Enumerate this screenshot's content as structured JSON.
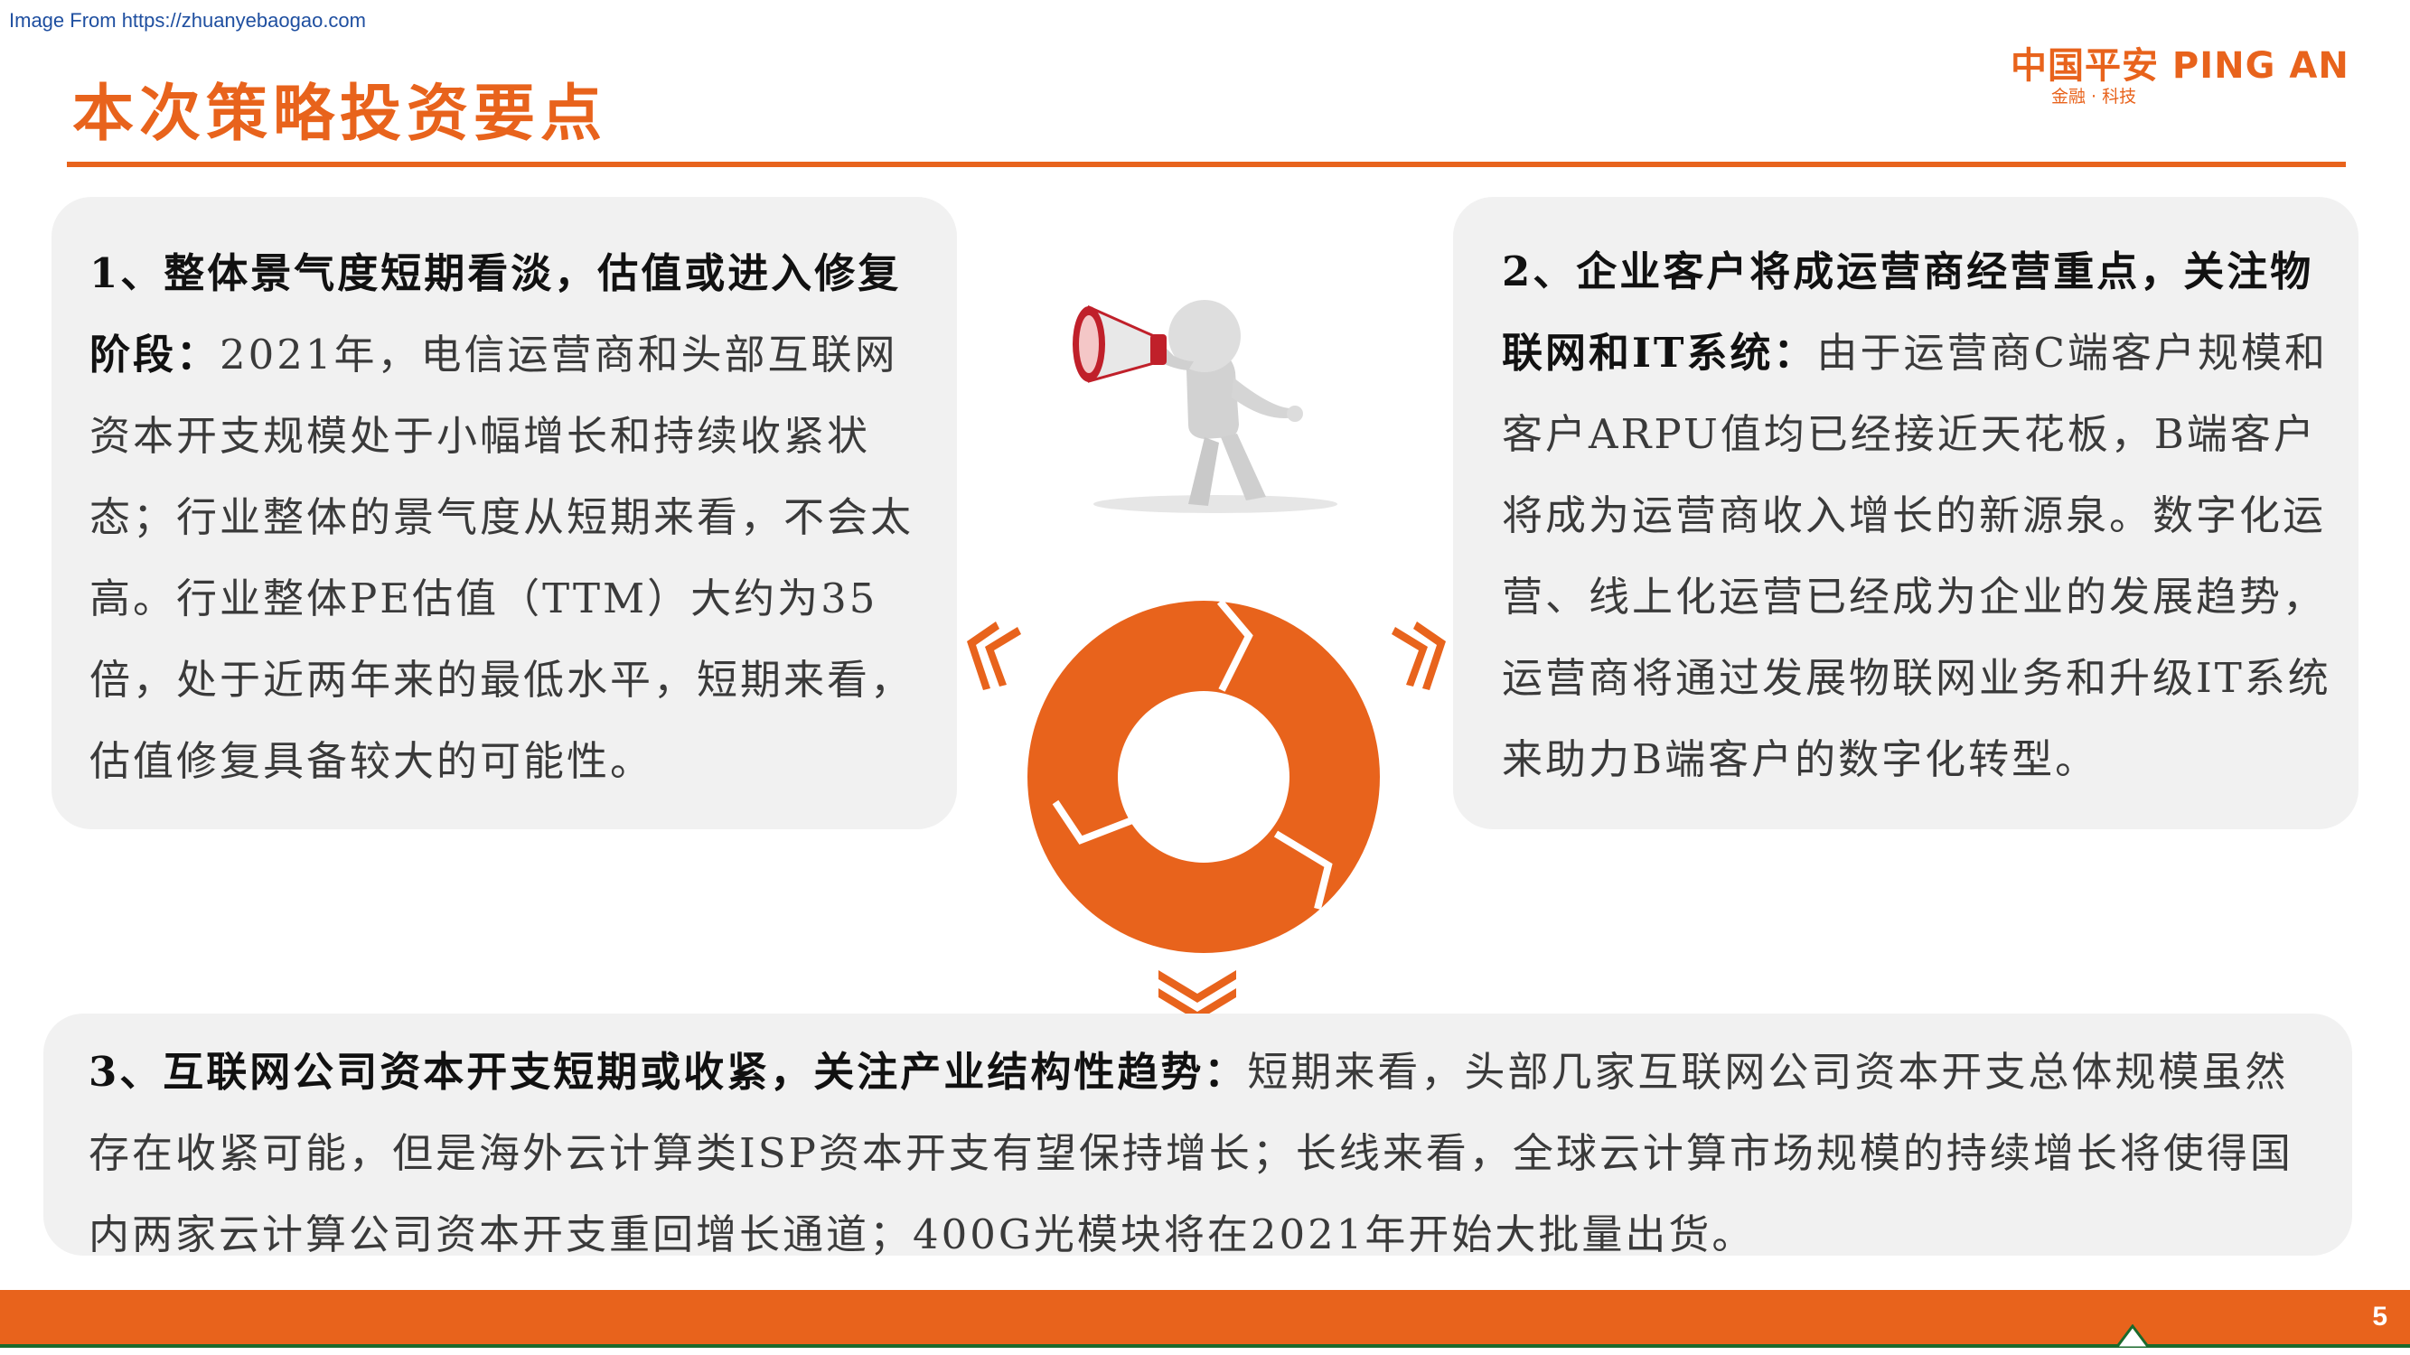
{
  "watermark": "Image From https://zhuanyebaogao.com",
  "title": "本次策略投资要点",
  "logo": {
    "brand": "中国平安 PING AN",
    "tagline": "金融 · 科技",
    "color": "#e8631c"
  },
  "points": [
    {
      "heading": "1、整体景气度短期看淡，估值或进入修复阶段：",
      "body": "2021年，电信运营商和头部互联网资本开支规模处于小幅增长和持续收紧状态；行业整体的景气度从短期来看，不会太高。行业整体PE估值（TTM）大约为35倍，处于近两年来的最低水平，短期来看，估值修复具备较大的可能性。"
    },
    {
      "heading": "2、企业客户将成运营商经营重点，关注物联网和IT系统：",
      "body": "由于运营商C端客户规模和客户ARPU值均已经接近天花板，B端客户将成为运营商收入增长的新源泉。数字化运营、线上化运营已经成为企业的发展趋势，运营商将通过发展物联网业务和升级IT系统来助力B端客户的数字化转型。"
    },
    {
      "heading": "3、互联网公司资本开支短期或收紧，关注产业结构性趋势：",
      "body": "短期来看，头部几家互联网公司资本开支总体规模虽然存在收紧可能，但是海外云计算类ISP资本开支有望保持增长；长线来看，全球云计算市场规模的持续增长将使得国内两家云计算公司资本开支重回增长通道；400G光模块将在2021年开始大批量出货。"
    }
  ],
  "graphics": {
    "figure": "person-megaphone-icon",
    "cycle": "cycle-ring-icon",
    "accent_color": "#e8631c",
    "card_color": "#f1f1f1"
  },
  "page_number": "5"
}
